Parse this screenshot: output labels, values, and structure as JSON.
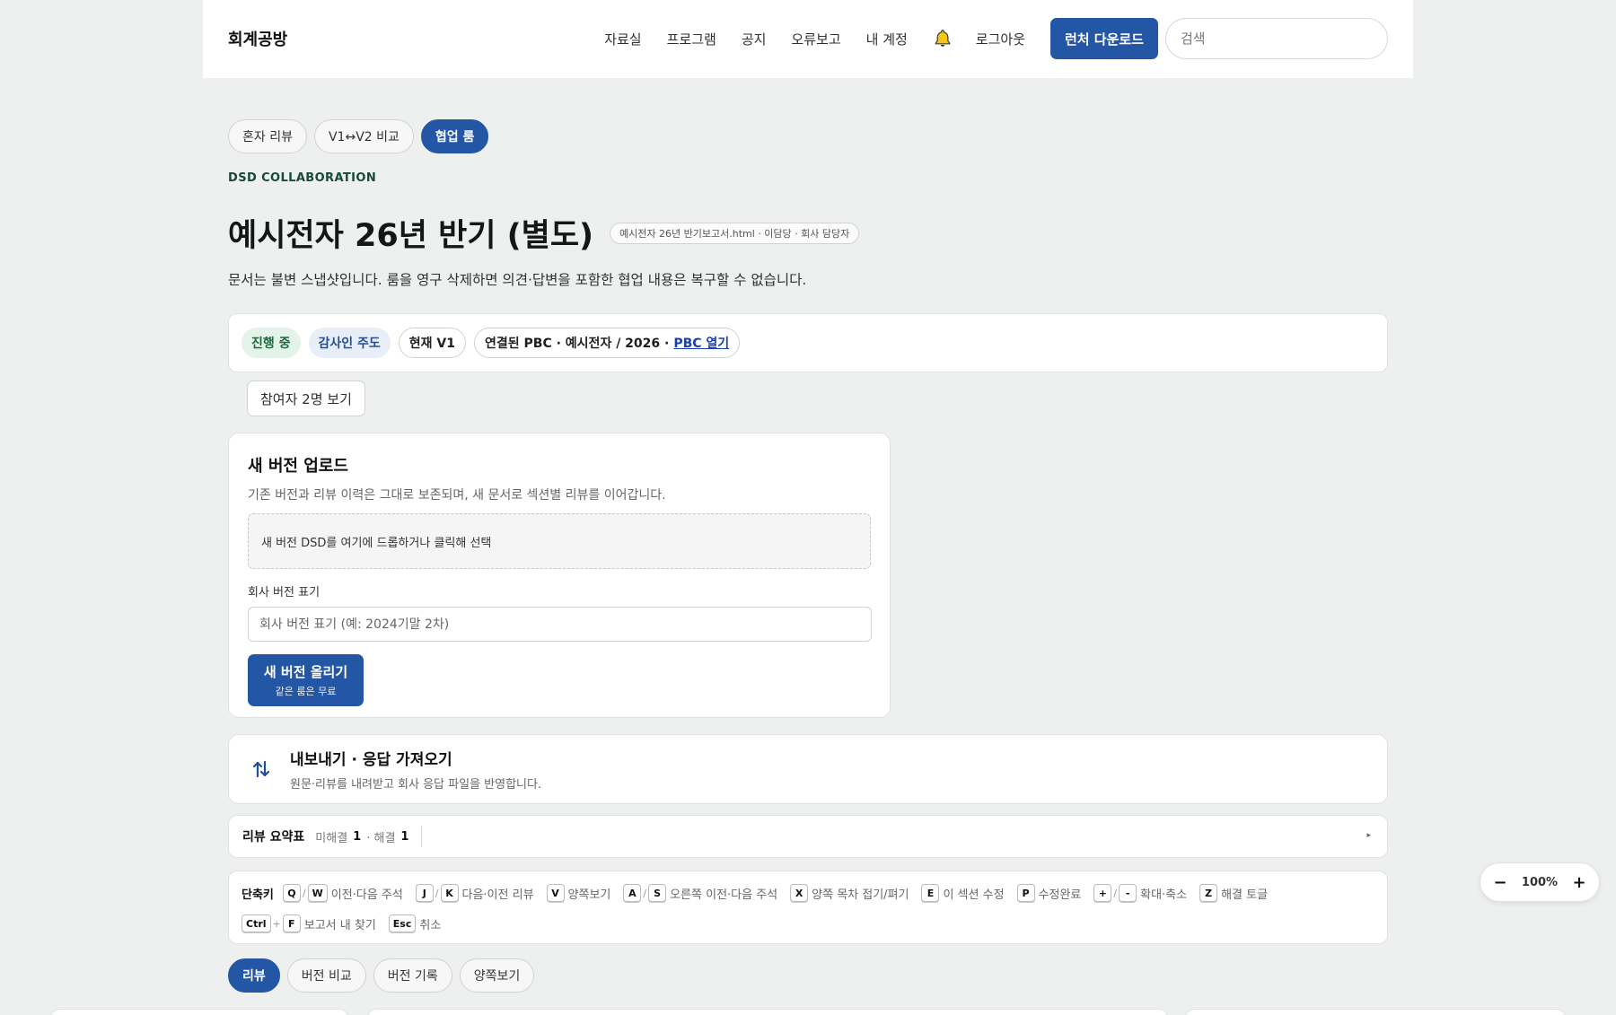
{
  "header": {
    "brand": "회계공방",
    "nav": [
      "자료실",
      "프로그램",
      "공지",
      "오류보고",
      "내 계정"
    ],
    "logout": "로그아웃",
    "launcher_button": "런처 다운로드",
    "search_placeholder": "검색"
  },
  "mode_tabs": [
    "혼자 리뷰",
    "V1↔V2 비교",
    "협업 룸"
  ],
  "eyebrow": "DSD COLLABORATION",
  "page_title": "예시전자 26년 반기 (별도)",
  "file_chip": "예시전자 26년 반기보고서.html · 이담당 · 회사 담당자",
  "page_desc": "문서는 불변 스냅샷입니다. 룸을 영구 삭제하면 의견·답변을 포함한 협업 내용은 복구할 수 없습니다.",
  "status": {
    "in_progress": "진행 중",
    "auditor_led": "감사인 주도",
    "current_version": "현재 V1",
    "pbc_text": "연결된 PBC · 예시전자 / 2026 ·",
    "pbc_link": "PBC 열기"
  },
  "participants_button": "참여자 2명 보기",
  "upload": {
    "title": "새 버전 업로드",
    "subtitle": "기존 버전과 리뷰 이력은 그대로 보존되며, 새 문서로 섹션별 리뷰를 이어갑니다.",
    "dropzone": "새 버전 DSD를 여기에 드롭하거나 클릭해 선택",
    "field_label": "회사 버전 표기",
    "field_placeholder": "회사 버전 표기 (예: 2024기말 2차)",
    "submit_main": "새 버전 올리기",
    "submit_sub": "같은 룸은 무료"
  },
  "io": {
    "title": "내보내기 · 응답 가져오기",
    "subtitle": "원문·리뷰를 내려받고 회사 응답 파일을 반영합니다."
  },
  "summary": {
    "title": "리뷰 요약표",
    "unresolved_label": "미해결",
    "unresolved_count": "1",
    "resolved_label": "· 해결",
    "resolved_count": "1",
    "caret": "▸"
  },
  "shortcuts": {
    "title": "단축키",
    "row1": [
      {
        "keys": [
          "Q",
          "W"
        ],
        "desc": "이전·다음 주석"
      },
      {
        "keys": [
          "J",
          "K"
        ],
        "desc": "다음·이전 리뷰"
      },
      {
        "keys": [
          "V"
        ],
        "desc": "양쪽보기"
      },
      {
        "keys": [
          "A",
          "S"
        ],
        "desc": "오른쪽 이전·다음 주석"
      },
      {
        "keys": [
          "X"
        ],
        "desc": "양쪽 목차 접기/펴기"
      },
      {
        "keys": [
          "E"
        ],
        "desc": "이 섹션 수정"
      },
      {
        "keys": [
          "P"
        ],
        "desc": "수정완료"
      },
      {
        "keys": [
          "+",
          "-"
        ],
        "desc": "확대·축소"
      },
      {
        "keys": [
          "Z"
        ],
        "desc": "해결 토글"
      }
    ],
    "row2": [
      {
        "keys": [
          "Ctrl",
          "F"
        ],
        "join": "+",
        "desc": "보고서 내 찾기"
      },
      {
        "keys": [
          "Esc"
        ],
        "desc": "취소"
      }
    ]
  },
  "view_tabs": [
    "리뷰",
    "버전 비교",
    "버전 기록",
    "양쪽보기"
  ],
  "zoom": {
    "minus": "−",
    "level": "100%",
    "plus": "+"
  },
  "colors": {
    "accent": "#2456a6",
    "green_badge": "#e4f3ea",
    "blue_badge": "#e7eef8",
    "eyebrow": "#17493a"
  }
}
